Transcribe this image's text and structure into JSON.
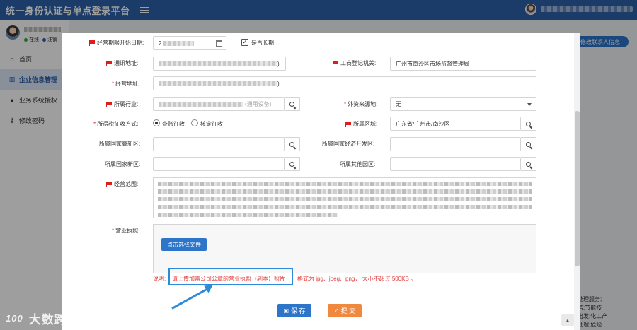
{
  "app": {
    "title": "统一身份认证与单点登录平台"
  },
  "user": {
    "status_online": "在线",
    "status_logout": "注销"
  },
  "sidebar": {
    "items": [
      {
        "label": "首页",
        "icon": "home-icon"
      },
      {
        "label": "企业信息管理",
        "icon": "bank-icon",
        "active": true
      },
      {
        "label": "业务系统授权",
        "icon": "users-icon"
      },
      {
        "label": "修改密码",
        "icon": "key-icon"
      }
    ]
  },
  "background": {
    "edit_contact_button": "修改联系人信息",
    "text_lines": [
      "处理服务;",
      "务;节能技",
      "出发;化工产",
      "处理;危险"
    ]
  },
  "form": {
    "op_start_date": {
      "label": "经营期限开始日期:",
      "value": "2"
    },
    "long_term": {
      "label": "是否长期",
      "checked": true
    },
    "mail_address": {
      "label": "通讯地址:",
      "value_suffix": ")"
    },
    "registration_authority": {
      "label": "工商登记机关:",
      "value": "广州市南沙区市场监督管理局"
    },
    "business_address": {
      "label": "经营地址:",
      "value_suffix": ")"
    },
    "industry": {
      "label": "所属行业:",
      "value_suffix": "(通用设备)"
    },
    "foreign_capital": {
      "label": "外资来源地:",
      "value": "无"
    },
    "tax_method": {
      "label": "所得税征收方式:",
      "options": [
        "查账征收",
        "核定征收"
      ],
      "selected": 0
    },
    "region": {
      "label": "所属区域:",
      "value": "广东省/广州市/南沙区"
    },
    "hightech_zone": {
      "label": "所属国家高新区:",
      "value": ""
    },
    "econ_zone": {
      "label": "所属国家经济开发区:",
      "value": ""
    },
    "new_area": {
      "label": "所属国家新区:",
      "value": ""
    },
    "other_park": {
      "label": "所属其他园区:",
      "value": ""
    },
    "business_scope": {
      "label": "经营范围:"
    },
    "license": {
      "label": "营业执照:",
      "button": "点击选择文件"
    }
  },
  "note": {
    "prefix": "说明:",
    "highlight": "请上传加盖公司公章的营业执照（副本）照片",
    "suffix": "格式为 jpg、jpeg、png， 大小不超过 500KB 。"
  },
  "footer": {
    "save": "保 存",
    "submit": "提 交"
  },
  "watermark": {
    "logo": "100",
    "text": "大数跨境"
  },
  "colors": {
    "header": "#2c5fa8",
    "primary": "#2c75c9",
    "orange": "#f0883e",
    "required": "#e21b1b",
    "note": "#e13b3b"
  }
}
